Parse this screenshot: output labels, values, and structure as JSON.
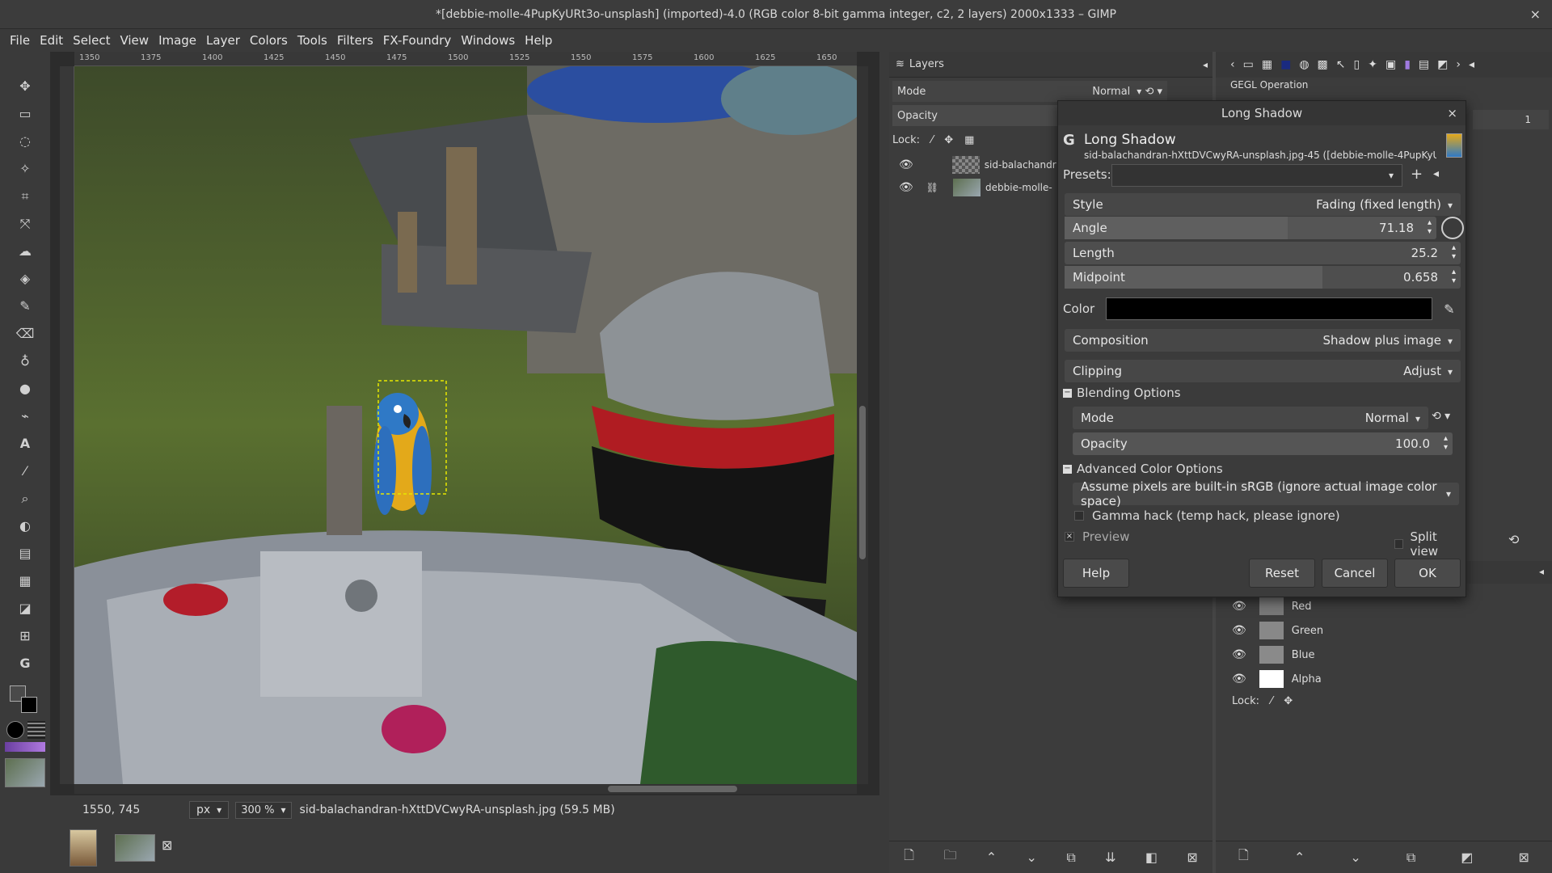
{
  "window": {
    "title": "*[debbie-molle-4PupKyURt3o-unsplash] (imported)-4.0 (RGB color 8-bit gamma integer, c2, 2 layers) 2000x1333 – GIMP",
    "close": "×"
  },
  "menu": [
    "File",
    "Edit",
    "Select",
    "View",
    "Image",
    "Layer",
    "Colors",
    "Tools",
    "Filters",
    "FX-Foundry",
    "Windows",
    "Help"
  ],
  "rulers": {
    "h_ticks": [
      "1350",
      "1375",
      "1400",
      "1425",
      "1450",
      "1475",
      "1500",
      "1525",
      "1550",
      "1575",
      "1600",
      "1625",
      "1650"
    ]
  },
  "status": {
    "coords": "1550, 745",
    "unit": "px",
    "zoom": "300 %",
    "info": "sid-balachandran-hXttDVCwyRA-unsplash.jpg (59.5 MB)"
  },
  "layers_panel": {
    "tab": "Layers",
    "mode_label": "Mode",
    "mode_value": "Normal",
    "opacity_label": "Opacity",
    "lock_label": "Lock:",
    "layers": [
      {
        "name": "sid-balachandr"
      },
      {
        "name": "debbie-molle-"
      }
    ]
  },
  "gegl": {
    "label": "GEGL Operation",
    "spin": "1"
  },
  "channels": {
    "items": [
      "Red",
      "Green",
      "Blue",
      "Alpha"
    ],
    "lock_label": "Lock:"
  },
  "dialog": {
    "title": "Long Shadow",
    "close": "×",
    "header": "Long Shadow",
    "subheader": "sid-balachandran-hXttDVCwyRA-unsplash.jpg-45 ([debbie-molle-4PupKyUR...",
    "presets_label": "Presets:",
    "style_label": "Style",
    "style_value": "Fading (fixed length)",
    "angle_label": "Angle",
    "angle_value": "71.18",
    "length_label": "Length",
    "length_value": "25.2",
    "midpoint_label": "Midpoint",
    "midpoint_value": "0.658",
    "color_label": "Color",
    "composition_label": "Composition",
    "composition_value": "Shadow plus image",
    "clipping_label": "Clipping",
    "clipping_value": "Adjust",
    "blending_header": "Blending Options",
    "blend_mode_label": "Mode",
    "blend_mode_value": "Normal",
    "blend_opacity_label": "Opacity",
    "blend_opacity_value": "100.0",
    "advanced_header": "Advanced Color Options",
    "advanced_value": "Assume pixels are built-in sRGB (ignore actual image color space)",
    "gamma_label": "Gamma hack (temp hack, please ignore)",
    "preview_label": "Preview",
    "split_label": "Split view",
    "help": "Help",
    "reset": "Reset",
    "cancel": "Cancel",
    "ok": "OK",
    "angle_fraction": 0.6,
    "midpoint_fraction": 0.65
  }
}
